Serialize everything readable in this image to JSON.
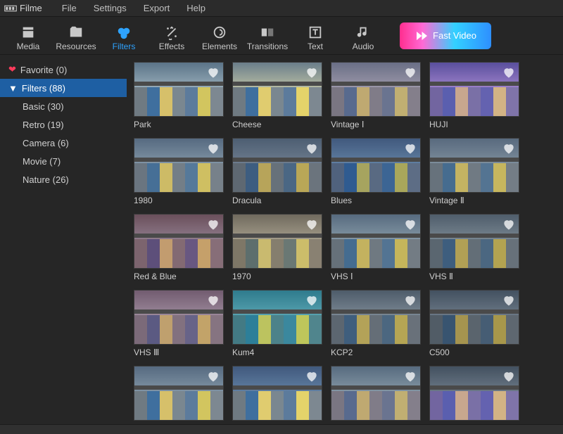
{
  "app": {
    "name": "Filme"
  },
  "menu": [
    "File",
    "Settings",
    "Export",
    "Help"
  ],
  "tabs": [
    {
      "id": "media",
      "label": "Media"
    },
    {
      "id": "resources",
      "label": "Resources"
    },
    {
      "id": "filters",
      "label": "Filters",
      "active": true
    },
    {
      "id": "effects",
      "label": "Effects"
    },
    {
      "id": "elements",
      "label": "Elements"
    },
    {
      "id": "transitions",
      "label": "Transitions"
    },
    {
      "id": "text",
      "label": "Text"
    },
    {
      "id": "audio",
      "label": "Audio"
    }
  ],
  "fast_video": {
    "label": "Fast Video"
  },
  "sidebar": {
    "favorite": {
      "label": "Favorite (0)"
    },
    "filters_header": {
      "label": "Filters (88)"
    },
    "subs": [
      {
        "id": "basic",
        "label": "Basic (30)"
      },
      {
        "id": "retro",
        "label": "Retro (19)"
      },
      {
        "id": "camera",
        "label": "Camera (6)"
      },
      {
        "id": "movie",
        "label": "Movie (7)"
      },
      {
        "id": "nature",
        "label": "Nature (26)"
      }
    ]
  },
  "filters": [
    {
      "id": "park",
      "label": "Park",
      "tint": "park"
    },
    {
      "id": "cheese",
      "label": "Cheese",
      "tint": "cheese"
    },
    {
      "id": "vintage1",
      "label": "Vintage Ⅰ",
      "tint": "vintage"
    },
    {
      "id": "huji",
      "label": "HUJI",
      "tint": "huji"
    },
    {
      "id": "1980",
      "label": "1980",
      "tint": "1980"
    },
    {
      "id": "dracula",
      "label": "Dracula",
      "tint": "dracula"
    },
    {
      "id": "blues",
      "label": "Blues",
      "tint": "blues"
    },
    {
      "id": "vintage2",
      "label": "Vintage Ⅱ",
      "tint": "vintage2"
    },
    {
      "id": "redblue",
      "label": "Red & Blue",
      "tint": "redblue"
    },
    {
      "id": "1970",
      "label": "1970",
      "tint": "1970"
    },
    {
      "id": "vhs1",
      "label": "VHS Ⅰ",
      "tint": "vhs1"
    },
    {
      "id": "vhs2",
      "label": "VHS Ⅱ",
      "tint": "vhs2"
    },
    {
      "id": "vhs3",
      "label": "VHS Ⅲ",
      "tint": "vhs3"
    },
    {
      "id": "kum4",
      "label": "Kum4",
      "tint": "kum4"
    },
    {
      "id": "kcp2",
      "label": "KCP2",
      "tint": "kcp2"
    },
    {
      "id": "c500",
      "label": "C500",
      "tint": "c500"
    },
    {
      "id": "extra1",
      "label": "",
      "tint": "1980"
    },
    {
      "id": "extra2",
      "label": "",
      "tint": "blues"
    },
    {
      "id": "extra3",
      "label": "",
      "tint": "vhs1"
    },
    {
      "id": "extra4",
      "label": "",
      "tint": "c500"
    }
  ],
  "house_colors": [
    [
      "#6f7a82",
      "#3f6f9e",
      "#d6c06a",
      "#7a8790",
      "#5c7b9c",
      "#d2c55f",
      "#7d8891"
    ],
    [
      "#6f7a82",
      "#3f6f9e",
      "#e0cc6f",
      "#7a8790",
      "#5c7b9c",
      "#e4d36a",
      "#7d8891"
    ],
    [
      "#7a7682",
      "#586a8e",
      "#bfa971",
      "#807c88",
      "#6a7490",
      "#c1af72",
      "#847f8b"
    ],
    [
      "#7265a0",
      "#5a5faf",
      "#c8a78e",
      "#7a70a6",
      "#6462b0",
      "#d2b385",
      "#7f74a9"
    ],
    [
      "#6a7580",
      "#466f96",
      "#cdbb66",
      "#737e87",
      "#55799a",
      "#cfbf62",
      "#77818a"
    ],
    [
      "#5e6872",
      "#3d5d80",
      "#b7a45a",
      "#67717a",
      "#4a6784",
      "#b9a757",
      "#6b747d"
    ],
    [
      "#50627d",
      "#2f5b90",
      "#a6a45f",
      "#596a82",
      "#3c6594",
      "#a9a75b",
      "#5d6d85"
    ],
    [
      "#67727c",
      "#466c8f",
      "#c4b362",
      "#707a83",
      "#547492",
      "#c6b65e",
      "#747d86"
    ],
    [
      "#7c646e",
      "#5d4f7a",
      "#c29c6f",
      "#836a73",
      "#685781",
      "#c5a06a",
      "#876e78"
    ],
    [
      "#7e7767",
      "#5d6e6d",
      "#c9ba6f",
      "#857e6e",
      "#6a7874",
      "#ccbd6a",
      "#898172"
    ],
    [
      "#66717a",
      "#446c90",
      "#c3b25f",
      "#6f7981",
      "#537493",
      "#c5b55b",
      "#737c84"
    ],
    [
      "#5a6670",
      "#3e5e7e",
      "#b1a055",
      "#636e77",
      "#4b6781",
      "#b3a351",
      "#67717a"
    ],
    [
      "#7b6a79",
      "#5b5a82",
      "#bfa06e",
      "#82717f",
      "#676388",
      "#c2a369",
      "#867481"
    ],
    [
      "#437a84",
      "#2d7f99",
      "#bcc35f",
      "#4c828a",
      "#3b889e",
      "#bec65b",
      "#50858d"
    ],
    [
      "#5c6670",
      "#3f5e7d",
      "#b3a258",
      "#656e77",
      "#4c6780",
      "#b5a554",
      "#69717a"
    ],
    [
      "#515c66",
      "#385470",
      "#a5944f",
      "#5a646d",
      "#465d74",
      "#a7974b",
      "#5e6770"
    ]
  ]
}
